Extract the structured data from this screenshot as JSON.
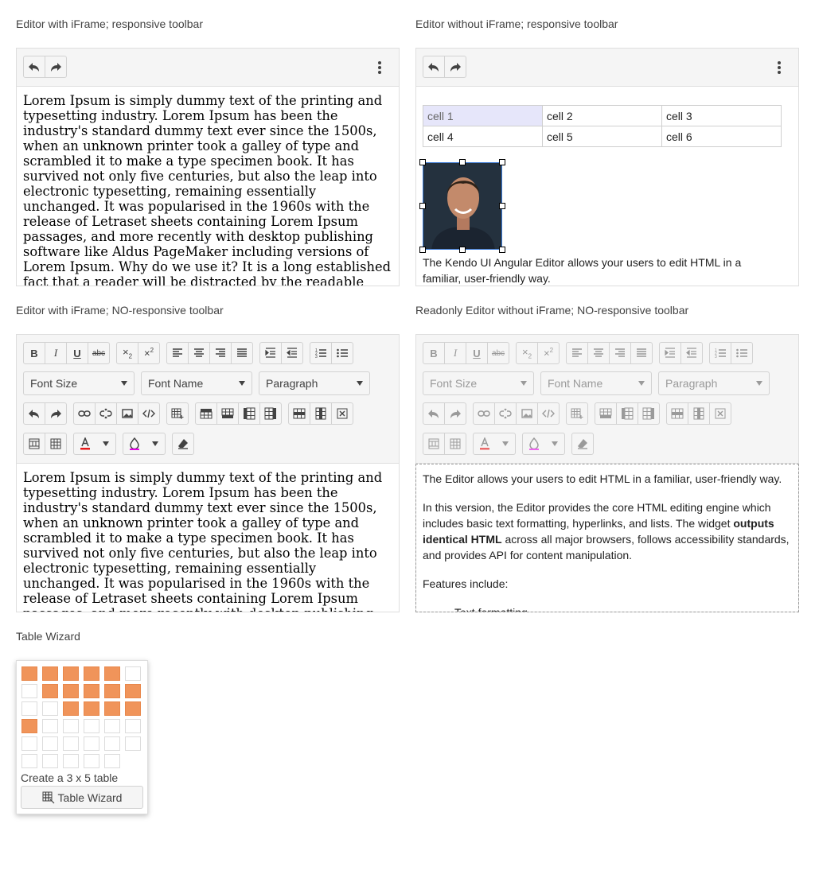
{
  "labels": {
    "editor1": "Editor with iFrame; responsive toolbar",
    "editor2": "Editor without iFrame; responsive toolbar",
    "editor3": "Editor with iFrame; NO-responsive toolbar",
    "editor4": "Readonly Editor without iFrame; NO-responsive toolbar",
    "wizard": "Table Wizard"
  },
  "lorem": "Lorem Ipsum is simply dummy text of the printing and typesetting industry. Lorem Ipsum has been the industry's standard dummy text ever since the 1500s, when an unknown printer took a galley of type and scrambled it to make a type specimen book. It has survived not only five centuries, but also the leap into electronic typesetting, remaining essentially unchanged. It was popularised in the 1960s with the release of Letraset sheets containing Lorem Ipsum passages, and more recently with desktop publishing software like Aldus PageMaker including versions of Lorem Ipsum. Why do we use it? It is a long established fact that a reader will be distracted by the readable content of a page when looking at its layout.",
  "editor2": {
    "cells": [
      [
        "cell 1",
        "cell 2",
        "cell 3"
      ],
      [
        "cell 4",
        "cell 5",
        "cell 6"
      ]
    ],
    "caption": "The Kendo UI Angular Editor allows your users to edit HTML in a familiar, user-friendly way."
  },
  "dropdowns": {
    "font_size": "Font Size",
    "font_name": "Font Name",
    "paragraph": "Paragraph"
  },
  "editor4": {
    "p1": "The Editor allows your users to edit HTML in a familiar, user-friendly way.",
    "p2_a": "In this version, the Editor provides the core HTML editing engine which includes basic text formatting, hyperlinks, and lists. The widget ",
    "p2_bold": "outputs identical HTML",
    "p2_b": " across all major browsers, follows accessibility standards, and provides API for content manipulation.",
    "p3": "Features include:",
    "li1": "Text formatting"
  },
  "wizard": {
    "status": "Create a 3 x 5 table",
    "button": "Table Wizard",
    "highlight_color": "#f0945a"
  },
  "colors": {
    "font_color": "#e51a1a",
    "background_color": "#e600e6"
  }
}
